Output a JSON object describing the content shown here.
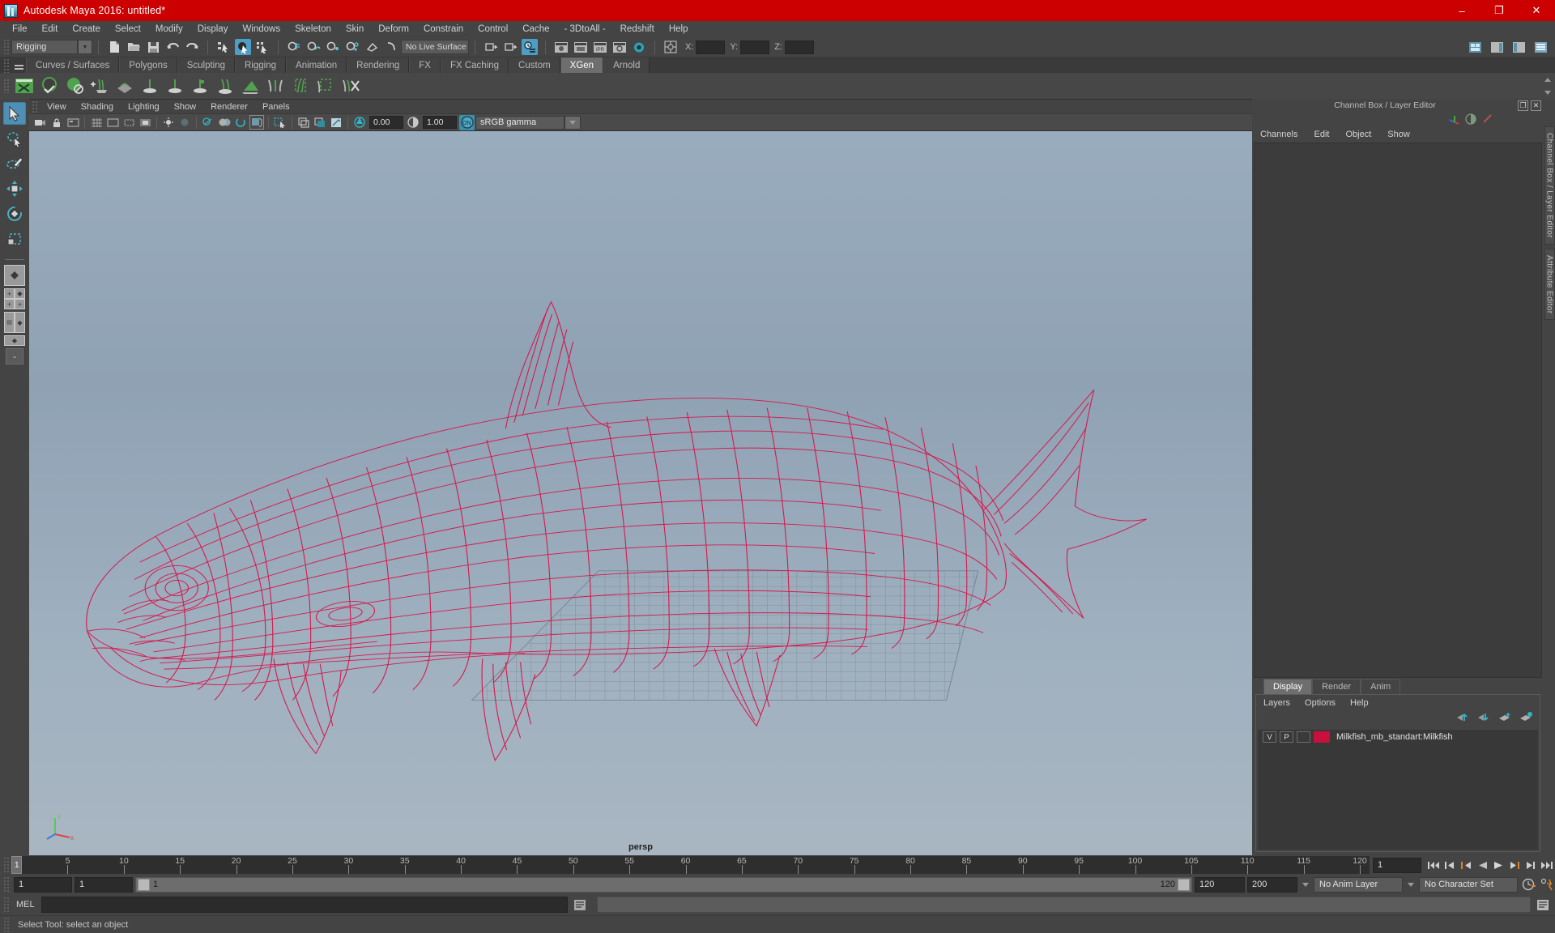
{
  "window": {
    "title": "Autodesk Maya 2016: untitled*",
    "app_icon": "maya-logo-icon",
    "minimize": "–",
    "maximize": "❐",
    "close": "✕",
    "title_bar_color": "#cc0000"
  },
  "menubar": {
    "items": [
      "File",
      "Edit",
      "Create",
      "Select",
      "Modify",
      "Display",
      "Windows",
      "Skeleton",
      "Skin",
      "Deform",
      "Constrain",
      "Control",
      "Cache",
      "- 3DtoAll -",
      "Redshift",
      "Help"
    ]
  },
  "statusline": {
    "menu_set": "Rigging",
    "live_surface": "No Live Surface",
    "coord_labels": {
      "x": "X:",
      "y": "Y:",
      "z": "Z:"
    },
    "coord_values": {
      "x": "",
      "y": "",
      "z": ""
    },
    "icons": [
      "new-scene-icon",
      "open-scene-icon",
      "save-scene-icon",
      "undo-icon",
      "redo-icon",
      "select-by-hierarchy-icon",
      "select-by-object-icon",
      "select-by-component-icon",
      "snap-to-grid-icon",
      "snap-to-curve-icon",
      "snap-to-point-icon",
      "snap-to-projected-center-icon",
      "snap-to-view-plane-icon",
      "make-live-icon",
      "show-manipulator-icon",
      "input-connections-icon",
      "output-connections-icon",
      "construction-history-icon",
      "render-current-frame-icon",
      "ipr-render-icon",
      "render-settings-icon",
      "hypershade-icon",
      "render-view-icon"
    ]
  },
  "shelf": {
    "tabs": [
      "Curves / Surfaces",
      "Polygons",
      "Sculpting",
      "Rigging",
      "Animation",
      "Rendering",
      "FX",
      "FX Caching",
      "Custom",
      "XGen",
      "Arnold"
    ],
    "active_tab": "XGen",
    "icons": [
      "xgen-editor-icon",
      "xgen-sphere-check-icon",
      "xgen-sphere-deny-icon",
      "xgen-add-guide-icon",
      "xgen-mask-icon",
      "xgen-groom-plant-icon",
      "xgen-groom-add-icon",
      "xgen-groom-eye-icon",
      "xgen-groom-lock-icon",
      "xgen-groom-comb-icon",
      "xgen-patch-icon",
      "xgen-clump-icon",
      "xgen-region-icon",
      "xgen-select-region-icon",
      "xgen-delete-icon"
    ]
  },
  "toolbox": {
    "tools": [
      {
        "name": "select-tool",
        "active": true
      },
      {
        "name": "lasso-select-tool",
        "active": false
      },
      {
        "name": "paint-select-tool",
        "active": false
      },
      {
        "name": "move-tool",
        "active": false
      },
      {
        "name": "rotate-tool",
        "active": false
      },
      {
        "name": "scale-tool",
        "active": false
      }
    ],
    "layouts": [
      "single-perspective-view-icon",
      "four-view-icon",
      "outliner-persp-icon",
      "hypergraph-persp-icon"
    ],
    "collapse_label": "-"
  },
  "viewport": {
    "menus": [
      "View",
      "Shading",
      "Lighting",
      "Show",
      "Renderer",
      "Panels"
    ],
    "camera_label": "persp",
    "toolbar": {
      "exposure": "0.00",
      "gamma": "1.00",
      "color_management": "sRGB gamma",
      "cm_enabled_label": "ON",
      "icons": [
        "select-camera-icon",
        "lock-camera-icon",
        "camera-attributes-icon",
        "grid-toggle-icon",
        "film-gate-icon",
        "resolution-gate-icon",
        "gate-mask-icon",
        "xray-toggle-icon",
        "xray-joints-icon",
        "xray-active-components-icon",
        "wireframe-shading-icon",
        "smooth-shade-all-icon",
        "smooth-shade-selected-icon",
        "flat-shade-icon",
        "wireframe-on-shaded-icon",
        "texture-toggle-icon",
        "use-all-lights-icon",
        "shadows-icon",
        "screen-space-ao-icon",
        "motion-blur-icon",
        "multisample-icon",
        "isolate-select-icon",
        "display-layer-icon",
        "two-sided-lighting-icon",
        "exposure-icon",
        "gamma-icon"
      ]
    },
    "model": {
      "name": "milkfish-wireframe",
      "wireframe_color": "#d41a4e",
      "background_top": "#99acbe",
      "background_bottom": "#a9b6c2"
    },
    "axis_labels": {
      "y": "y",
      "x": "x",
      "z": "z"
    }
  },
  "channelbox": {
    "panel_title": "Channel Box / Layer Editor",
    "menus": [
      "Channels",
      "Edit",
      "Object",
      "Show"
    ],
    "undock_label": "❐",
    "close_label": "✕",
    "header_icons": [
      "channel-box-icon",
      "attribute-editor-icon",
      "tool-settings-icon"
    ],
    "content": ""
  },
  "layereditor": {
    "tabs": [
      "Display",
      "Render",
      "Anim"
    ],
    "active_tab": "Display",
    "menus": [
      "Layers",
      "Options",
      "Help"
    ],
    "tool_icons": [
      "move-layer-up-icon",
      "move-layer-down-icon",
      "new-layer-icon",
      "new-layer-from-selected-icon"
    ],
    "layers": [
      {
        "visibility": "V",
        "playback": "P",
        "shading": "",
        "color": "#c9103c",
        "name": "Milkfish_mb_standart:Milkfish"
      }
    ]
  },
  "vertical_tabs": [
    "Channel Box / Layer Editor",
    "Attribute Editor"
  ],
  "timeslider": {
    "start_frame": "1",
    "current_frame": "1",
    "ticks": [
      1,
      5,
      10,
      15,
      20,
      25,
      30,
      35,
      40,
      45,
      50,
      55,
      60,
      65,
      70,
      75,
      80,
      85,
      90,
      95,
      100,
      105,
      110,
      115,
      120
    ],
    "tick_labels": [
      "1",
      "5",
      "10",
      "15",
      "20",
      "25",
      "30",
      "35",
      "40",
      "45",
      "50",
      "55",
      "60",
      "65",
      "70",
      "75",
      "80",
      "85",
      "90",
      "95",
      "100",
      "105",
      "110",
      "115",
      "120"
    ],
    "current_frame_field": "1",
    "playback_buttons": [
      "go-to-start-icon",
      "step-back-frame-icon",
      "step-back-key-icon",
      "play-backwards-icon",
      "play-forwards-icon",
      "step-forward-key-icon",
      "step-forward-frame-icon",
      "go-to-end-icon"
    ]
  },
  "rangeslider": {
    "anim_start": "1",
    "range_start": "1",
    "slider_start_label": "1",
    "slider_end_label": "120",
    "range_end": "120",
    "anim_end": "200",
    "anim_layer": "No Anim Layer",
    "character_set": "No Character Set",
    "auto_key_icon": "auto-keyframe-icon",
    "anim_prefs_icon": "animation-preferences-icon"
  },
  "commandline": {
    "language_label": "MEL",
    "input_value": "",
    "output_value": "",
    "script_editor_icon": "script-editor-icon"
  },
  "helpline": {
    "text": "Select Tool: select an object"
  },
  "colors": {
    "accent_blue": "#4e9dc4",
    "shelf_green": "#5cb85c",
    "wire_red": "#d41a4e",
    "title_red": "#cc0000",
    "panel_bg": "#444444"
  }
}
